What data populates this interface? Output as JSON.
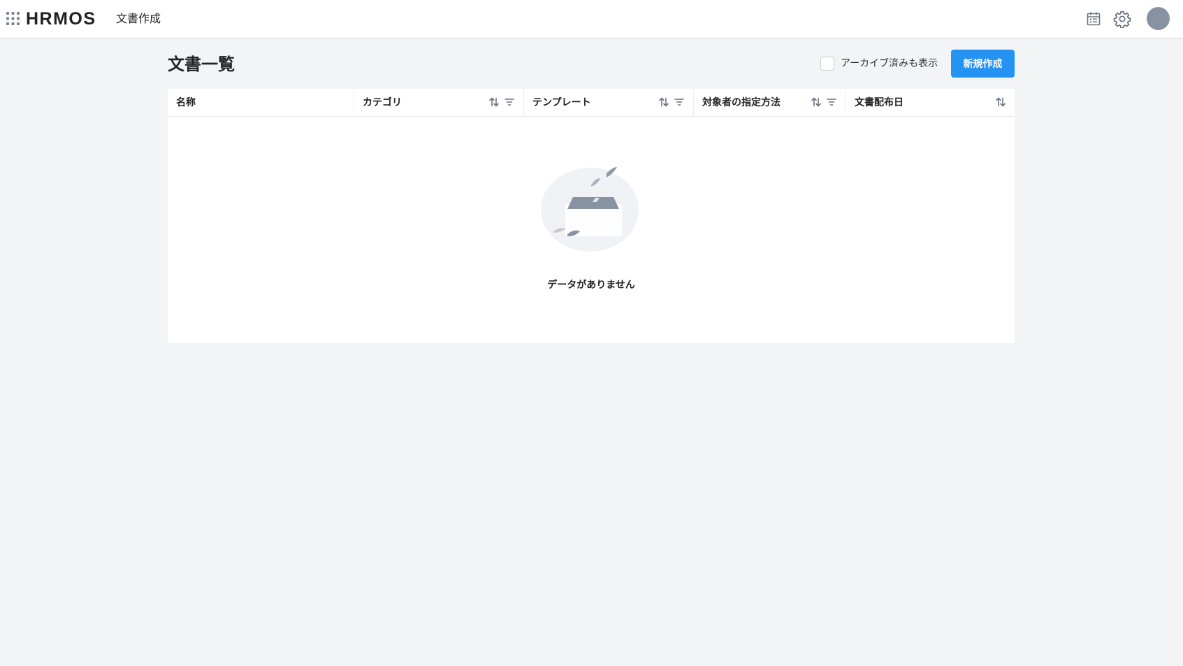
{
  "header": {
    "logo_text": "HRMOS",
    "product_name": "文書作成"
  },
  "page": {
    "title": "文書一覧",
    "archive_toggle_label": "アーカイブ済みも表示",
    "new_button_label": "新規作成"
  },
  "table": {
    "columns": [
      {
        "label": "名称",
        "sortable": false,
        "filterable": false
      },
      {
        "label": "カテゴリ",
        "sortable": true,
        "filterable": true
      },
      {
        "label": "テンプレート",
        "sortable": true,
        "filterable": true
      },
      {
        "label": "対象者の指定方法",
        "sortable": true,
        "filterable": true
      },
      {
        "label": "文書配布日",
        "sortable": true,
        "filterable": false
      }
    ],
    "empty_message": "データがありません"
  },
  "colors": {
    "accent": "#2493f2",
    "avatar": "#8792a3",
    "icon_gray": "#6b7280",
    "background": "#f3f4f6"
  },
  "icons": {
    "apps": "grid-dots-icon",
    "calendar": "calendar-icon",
    "settings": "gear-icon",
    "sort": "sort-arrows-icon",
    "filter": "filter-icon",
    "empty": "empty-box-illustration"
  }
}
